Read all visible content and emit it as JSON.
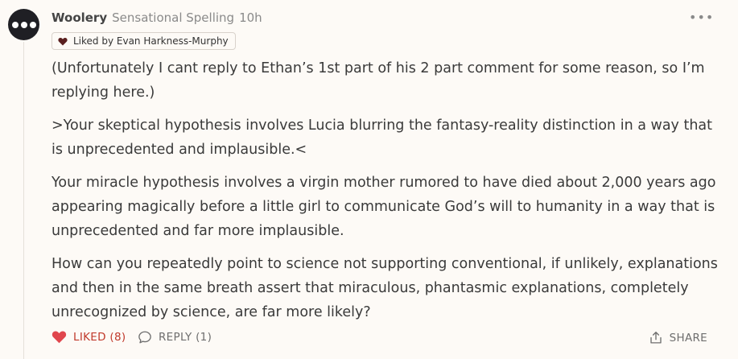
{
  "comment": {
    "author": "Woolery",
    "flair": "Sensational Spelling",
    "time": "10h",
    "liked_by": "Liked by Evan Harkness-Murphy",
    "paragraphs": [
      "(Unfortunately I cant reply to Ethan’s 1st part of his 2 part comment for some reason, so I’m replying here.)",
      ">Your skeptical hypothesis involves Lucia blurring the fantasy-reality distinction in a way that is unprecedented and implausible.<",
      "Your miracle hypothesis involves a virgin mother rumored to have died about 2,000 years ago appearing magically before a little girl to communicate God’s will to humanity in a way that is unprecedented and far more implausible.",
      "How can you repeatedly point to science not supporting conventional, if unlikely, explanations and then in the same breath assert that miraculous, phantasmic explanations, completely unrecognized by science, are far more likely?"
    ],
    "menu_glyph": "•••"
  },
  "actions": {
    "like_label": "LIKED (8)",
    "reply_label": "REPLY (1)",
    "share_label": "SHARE"
  },
  "colors": {
    "like_red": "#e0464d",
    "liked_text": "#c0392b",
    "badge_heart": "#5a1f1f",
    "avatar_bg": "#1f1f24",
    "background": "#fdfaf6"
  },
  "icons": {
    "avatar": "three-dots-avatar",
    "badge": "heart-icon",
    "like": "heart-icon",
    "reply": "speech-bubble-icon",
    "share": "share-upload-icon",
    "menu": "more-horizontal-icon"
  }
}
